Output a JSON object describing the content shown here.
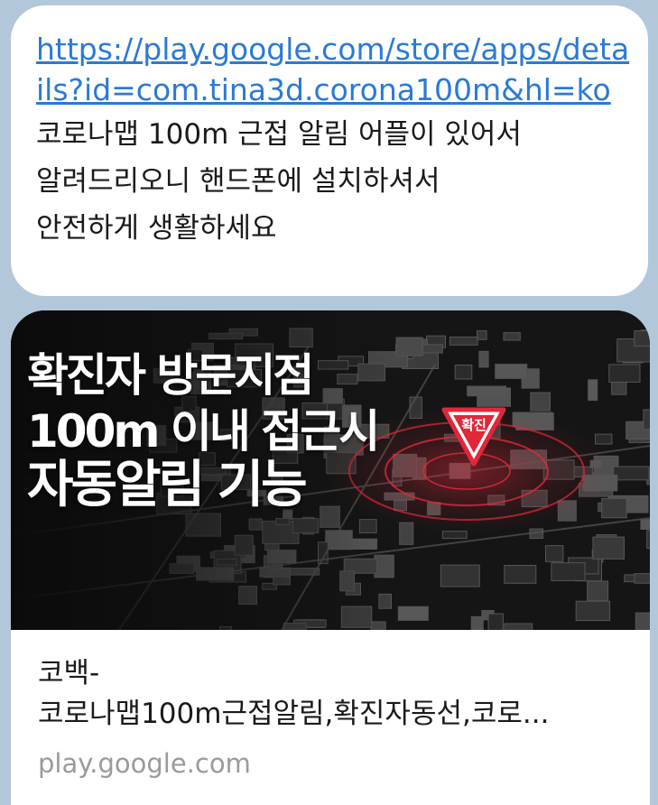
{
  "message": {
    "link": "https://play.google.com/store/apps/details?id=com.tina3d.corona100m&hl=ko",
    "text": "코로나맵 100m 근접 알림 어플이 있어서\n알려드리오니 핸드폰에 설치하셔서\n안전하게 생활하세요"
  },
  "link_preview": {
    "image": {
      "headline_lines": [
        "확진자 방문지점",
        "100m 이내 접근시",
        "자동알림 기능"
      ],
      "marker_label": "확진"
    },
    "title_lines": [
      "코백-",
      "코로나맵100m근접알림,확진자동선,코로..."
    ],
    "domain": "play.google.com"
  },
  "colors": {
    "background": "#b2c7da",
    "bubble": "#ffffff",
    "link": "#2a7ad6",
    "marker": "#e0283a",
    "domain_text": "#9a9a9a"
  }
}
